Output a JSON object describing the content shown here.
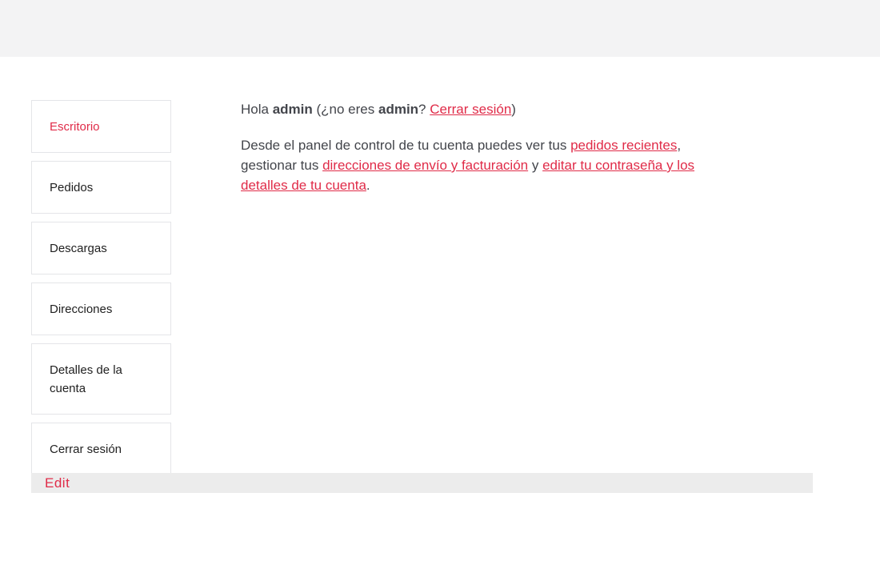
{
  "account_nav": {
    "items": [
      {
        "label": "Escritorio",
        "active": true
      },
      {
        "label": "Pedidos"
      },
      {
        "label": "Descargas"
      },
      {
        "label": "Direcciones"
      },
      {
        "label": "Detalles de la cuenta"
      },
      {
        "label": "Cerrar sesión"
      }
    ]
  },
  "dashboard": {
    "greeting": {
      "hello": "Hola",
      "username": "admin",
      "not_you_open": "(¿no eres",
      "username2": "admin",
      "question_mark": "?",
      "logout_link": "Cerrar sesión",
      "close_paren": ")"
    },
    "intro": {
      "text1": "Desde el panel de control de tu cuenta puedes ver tus",
      "recent_orders_link": "pedidos recientes",
      "text2": ", gestionar tus",
      "addresses_link": "direcciones de envío y facturación",
      "text3": "y",
      "account_details_link": "editar tu contraseña y los detalles de tu cuenta",
      "text4": "."
    }
  },
  "edit_bar": {
    "edit_label": "Edit"
  },
  "colors": {
    "accent": "#e02b48",
    "topbar": "#f3f3f4",
    "editbar": "#ececec"
  }
}
